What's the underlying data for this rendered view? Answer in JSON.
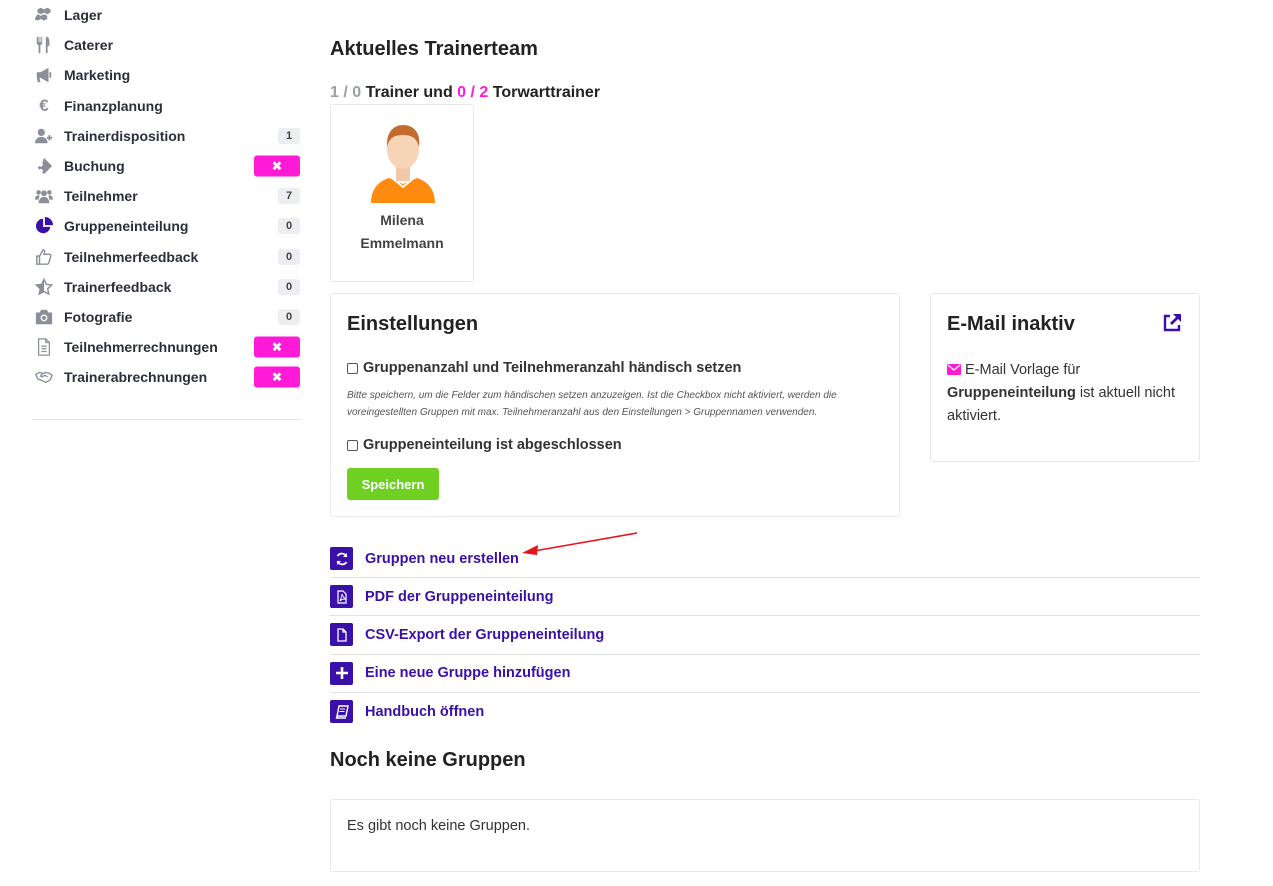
{
  "sidebar": {
    "items": [
      {
        "label": "Lager",
        "icon": "cubes-icon"
      },
      {
        "label": "Caterer",
        "icon": "cutlery-icon"
      },
      {
        "label": "Marketing",
        "icon": "megaphone-icon"
      },
      {
        "label": "Finanzplanung",
        "icon": "euro-icon"
      },
      {
        "label": "Trainerdisposition",
        "icon": "user-plus-icon",
        "badge": "1"
      },
      {
        "label": "Buchung",
        "icon": "ticket-icon",
        "badge_x": "✖"
      },
      {
        "label": "Teilnehmer",
        "icon": "users-icon",
        "badge": "7"
      },
      {
        "label": "Gruppeneinteilung",
        "icon": "pie-chart-icon",
        "badge": "0"
      },
      {
        "label": "Teilnehmerfeedback",
        "icon": "thumbs-up-icon",
        "badge": "0"
      },
      {
        "label": "Trainerfeedback",
        "icon": "star-half-icon",
        "badge": "0"
      },
      {
        "label": "Fotografie",
        "icon": "camera-icon",
        "badge": "0"
      },
      {
        "label": "Teilnehmerrechnungen",
        "icon": "file-text-icon",
        "badge_x": "✖"
      },
      {
        "label": "Trainerabrechnungen",
        "icon": "handshake-icon",
        "badge_x": "✖"
      }
    ]
  },
  "team": {
    "title": "Aktuelles Trainerteam",
    "trainer_current": "1",
    "trainer_sep": " / ",
    "trainer_needed": "0",
    "trainer_label": " Trainer und ",
    "goalie_current": "0",
    "goalie_sep": " / ",
    "goalie_needed": "2",
    "goalie_label": " Torwarttrainer",
    "trainer": {
      "first_name": "Milena",
      "last_name": "Emmelmann"
    }
  },
  "settings": {
    "title": "Einstellungen",
    "checkbox1": "Gruppenanzahl und Teilnehmeranzahl händisch setzen",
    "hint": "Bitte speichern, um die Felder zum händischen setzen anzuzeigen. Ist die Checkbox nicht aktiviert, werden die voreingestellten Gruppen mit max. Teilnehmeranzahl aus den Einstellungen > Gruppennamen verwenden.",
    "checkbox2": "Gruppeneinteilung ist abgeschlossen",
    "save_label": "Speichern"
  },
  "email": {
    "title": "E-Mail inaktiv",
    "text_prefix": "E-Mail Vorlage für",
    "text_bold": "Gruppeneinteilung",
    "text_suffix": " ist aktuell nicht aktiviert."
  },
  "actions": [
    {
      "label": "Gruppen neu erstellen",
      "icon": "refresh-icon"
    },
    {
      "label": "PDF der Gruppeneinteilung",
      "icon": "pdf-file-icon"
    },
    {
      "label": "CSV-Export der Gruppeneinteilung",
      "icon": "file-icon"
    },
    {
      "label": "Eine neue Gruppe hinzufügen",
      "icon": "plus-icon"
    },
    {
      "label": "Handbuch öffnen",
      "icon": "book-icon"
    }
  ],
  "groups": {
    "title": "Noch keine Gruppen",
    "empty_text": "Es gibt noch keine Gruppen."
  },
  "colors": {
    "accent": "#3a10a8",
    "pink": "#ff1ad8",
    "green": "#6fd021",
    "annotation_arrow": "#e8141c"
  }
}
